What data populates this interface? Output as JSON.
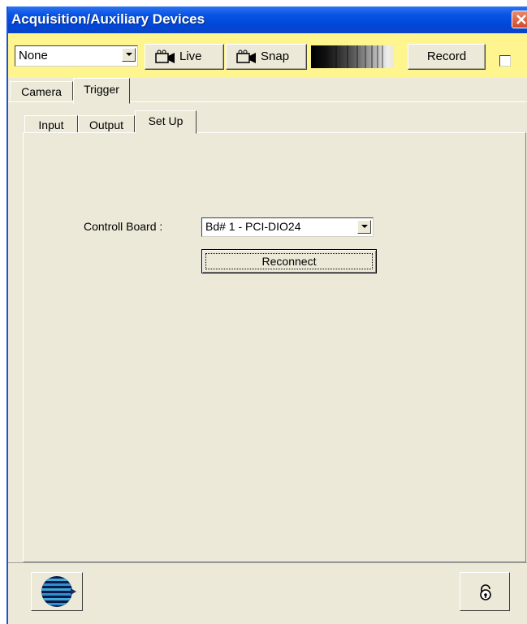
{
  "window": {
    "title": "Acquisition/Auxiliary Devices"
  },
  "toolbar": {
    "device_select": "None",
    "live_label": "Live",
    "snap_label": "Snap",
    "record_label": "Record",
    "record_checkbox_checked": false
  },
  "tabs": {
    "top": [
      "Camera",
      "Trigger"
    ],
    "top_selected": "Trigger",
    "sub": [
      "Input",
      "Output",
      "Set Up"
    ],
    "sub_selected": "Set Up"
  },
  "setup": {
    "controll_board_label": "Controll Board :",
    "controll_board_value": "Bd# 1 - PCI-DIO24",
    "reconnect_label": "Reconnect"
  },
  "colors": {
    "titlebar": "#0046d8",
    "toolbar_bg": "#fff58e",
    "window_bg": "#ece9d8",
    "close_button": "#d4482a"
  },
  "icons": {
    "live": "camera-icon",
    "snap": "camera-icon",
    "logo": "globe-logo-icon",
    "lock": "unlock-icon",
    "close": "close-icon"
  }
}
